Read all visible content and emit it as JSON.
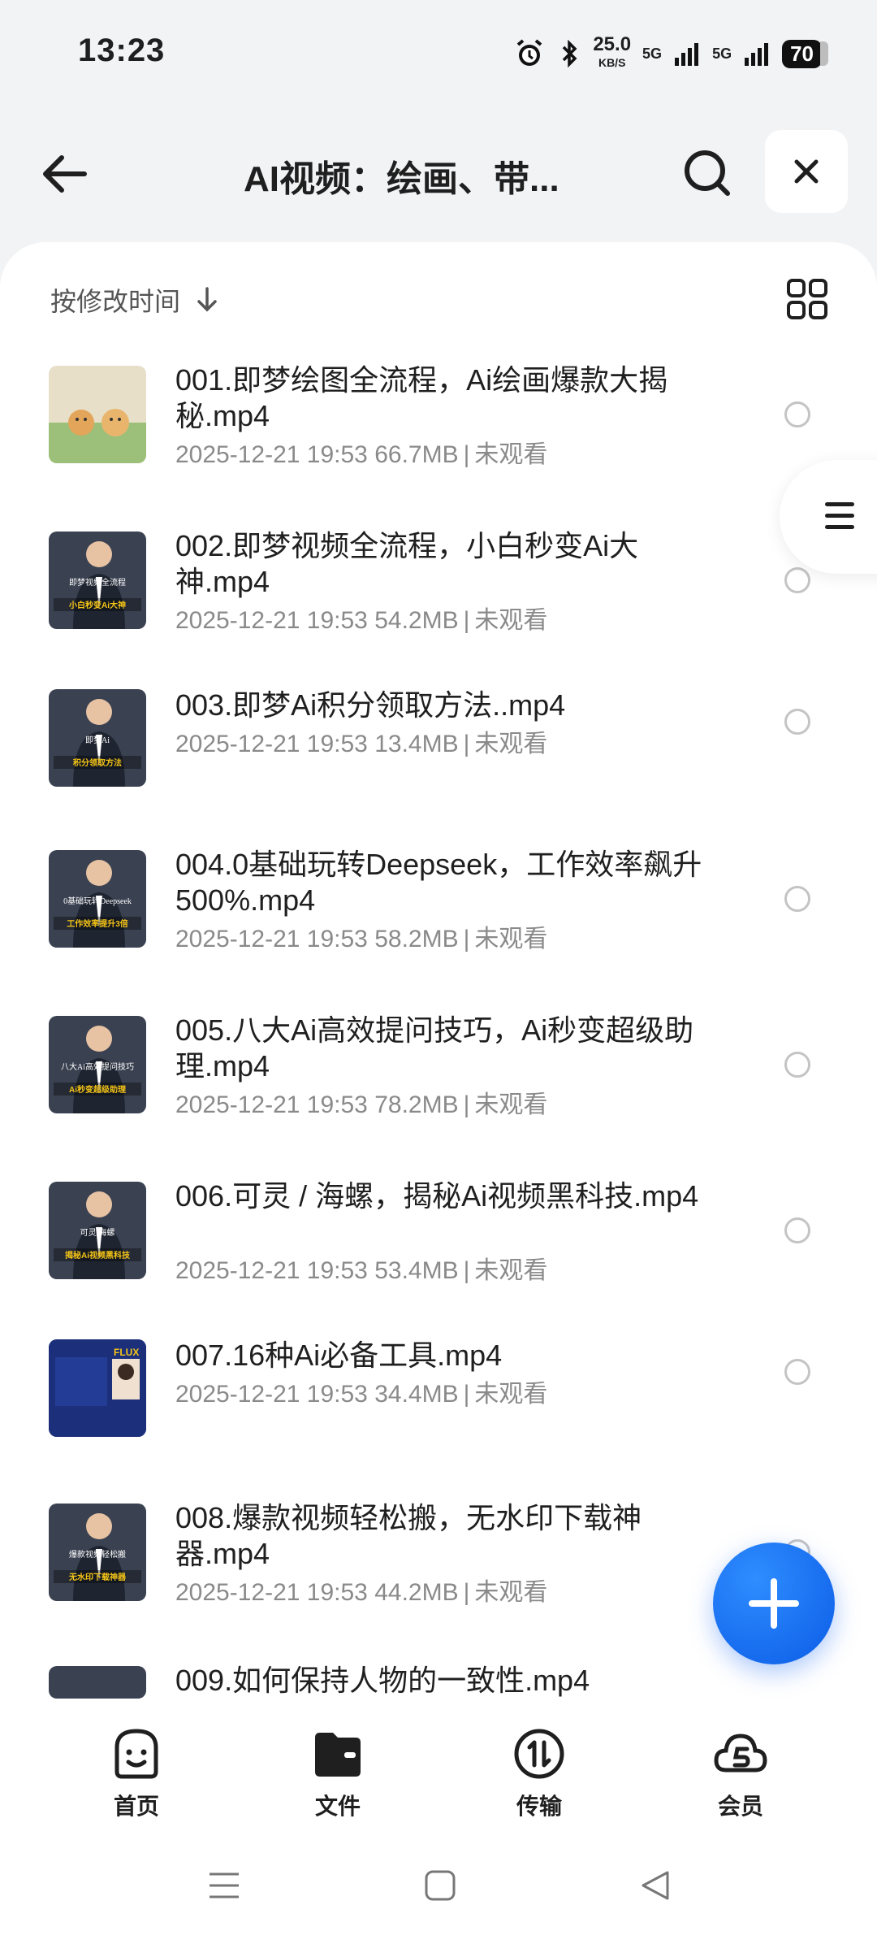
{
  "status_bar": {
    "time": "13:23",
    "net_speed": "25.0",
    "net_unit": "KB/S",
    "signal1": "5G",
    "signal2": "5G",
    "battery": "70"
  },
  "header": {
    "title": "AI视频：绘画、带..."
  },
  "sort": {
    "label": "按修改时间"
  },
  "files": [
    {
      "name": "001.即梦绘图全流程，Ai绘画爆款大揭秘.mp4",
      "date": "2025-12-21 19:53",
      "size": "66.7MB",
      "status": "未观看",
      "thumb_text": "",
      "thumb_sub": ""
    },
    {
      "name": "002.即梦视频全流程，小白秒变Ai大神.mp4",
      "date": "2025-12-21 19:53",
      "size": "54.2MB",
      "status": "未观看",
      "thumb_text": "即梦视频全流程",
      "thumb_sub": "小白秒变Ai大神"
    },
    {
      "name": "003.即梦Ai积分领取方法..mp4",
      "date": "2025-12-21 19:53",
      "size": "13.4MB",
      "status": "未观看",
      "thumb_text": "即梦Ai",
      "thumb_sub": "积分领取方法"
    },
    {
      "name": "004.0基础玩转Deepseek，工作效率飙升500%.mp4",
      "date": "2025-12-21 19:53",
      "size": "58.2MB",
      "status": "未观看",
      "thumb_text": "0基础玩转Deepseek",
      "thumb_sub": "工作效率提升3倍"
    },
    {
      "name": "005.八大Ai高效提问技巧，Ai秒变超级助理.mp4",
      "date": "2025-12-21 19:53",
      "size": "78.2MB",
      "status": "未观看",
      "thumb_text": "八大Ai高效提问技巧",
      "thumb_sub": "Ai秒变超级助理"
    },
    {
      "name": "006.可灵 / 海螺，揭秘Ai视频黑科技.mp4",
      "date": "2025-12-21 19:53",
      "size": "53.4MB",
      "status": "未观看",
      "thumb_text": "可灵/海螺",
      "thumb_sub": "揭秘Ai视频黑科技"
    },
    {
      "name": "007.16种Ai必备工具.mp4",
      "date": "2025-12-21 19:53",
      "size": "34.4MB",
      "status": "未观看",
      "thumb_text": "FLUX",
      "thumb_sub": ""
    },
    {
      "name": "008.爆款视频轻松搬，无水印下载神器.mp4",
      "date": "2025-12-21 19:53",
      "size": "44.2MB",
      "status": "未观看",
      "thumb_text": "爆款视频轻松搬",
      "thumb_sub": "无水印下载神器"
    },
    {
      "name": "009.如何保持人物的一致性.mp4",
      "date": "",
      "size": "",
      "status": "",
      "thumb_text": "",
      "thumb_sub": ""
    }
  ],
  "tabs": [
    {
      "label": "首页",
      "icon": "smile-face-icon"
    },
    {
      "label": "文件",
      "icon": "folder-icon"
    },
    {
      "label": "传输",
      "icon": "transfer-icon"
    },
    {
      "label": "会员",
      "icon": "cloud-vip-icon"
    }
  ],
  "colors": {
    "accent": "#0b5ce6",
    "background": "#f2f3f5",
    "thumb_dark": "#2c3340",
    "thumb_label": "#f5c518"
  }
}
